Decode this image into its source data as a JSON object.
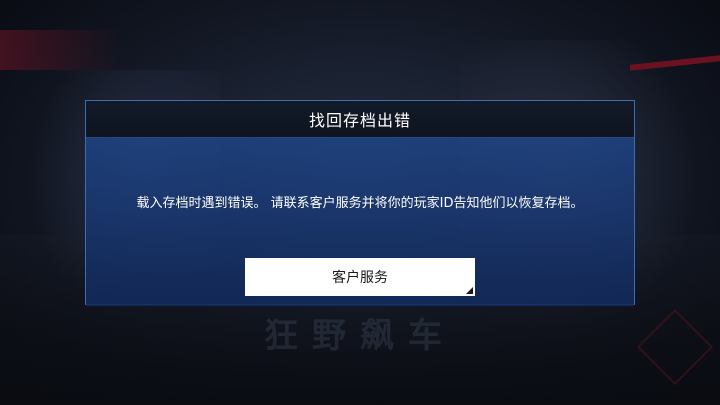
{
  "dialog": {
    "title": "找回存档出错",
    "message": "载入存档时遇到错误。 请联系客户服务并将你的玩家ID告知他们以恢复存档。",
    "button_label": "客户服务"
  },
  "background": {
    "logo_text": "狂野飙车"
  },
  "colors": {
    "dialog_border": "#3f6eb0",
    "dialog_body": "#1e468c",
    "header_bg": "#121a28",
    "button_bg": "#ffffff"
  }
}
